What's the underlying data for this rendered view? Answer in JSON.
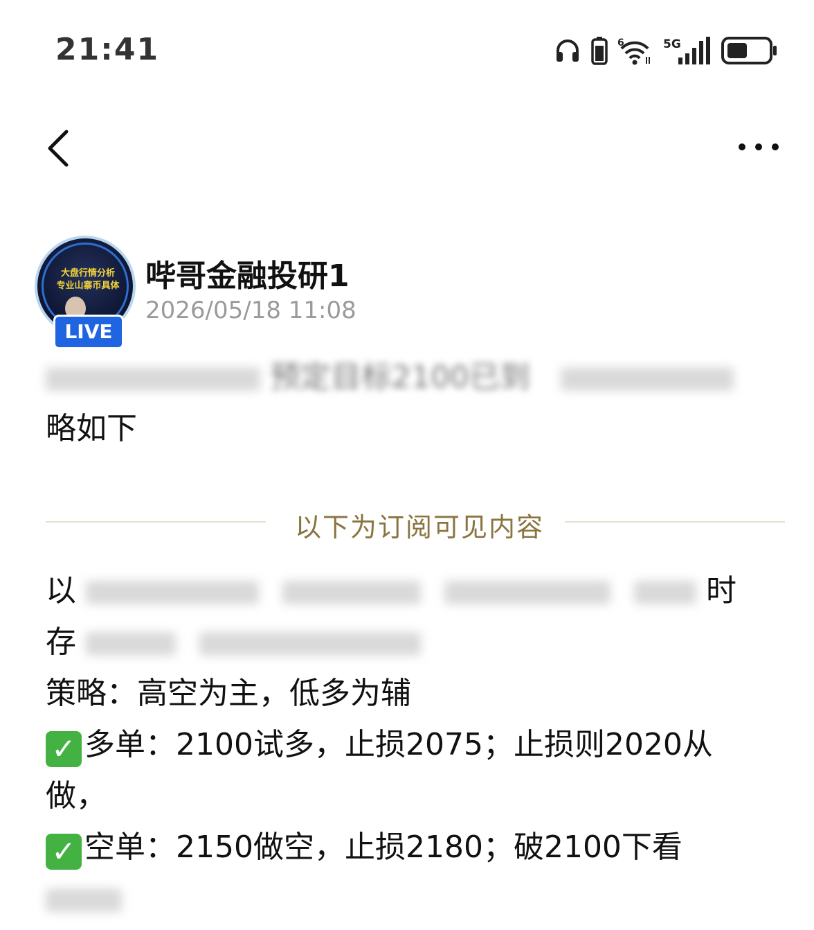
{
  "status_bar": {
    "time": "21:41",
    "icons": [
      "headphones-icon",
      "battery-small-icon",
      "wifi-icon",
      "5g-signal-icon",
      "battery-icon"
    ],
    "network_label": "5G",
    "wifi_label": "6"
  },
  "nav": {
    "back_icon": "chevron-left-icon",
    "more_icon": "more-dots-icon"
  },
  "author": {
    "name": "哔哥金融投研1",
    "time": "2026/05/18 11:08",
    "live_badge": "LIVE",
    "avatar_text_line1": "大盘行情分析",
    "avatar_text_line2": "专业山寨币具体"
  },
  "post": {
    "intro_line1_visible": "预定目标2100已到",
    "intro_line2": "略如下",
    "divider_label": "以下为订阅可见内容",
    "para1_line1_start": "以",
    "para1_line1_end": "时",
    "para1_line2_start": "存",
    "strategy_line": "策略：高空为主，低多为辅",
    "long_line": "多单：2100试多，止损2075；止损则2020从",
    "long_line_cont": "做，",
    "short_line": "空单：2150做空，止损2180；破2100下看"
  },
  "colors": {
    "accent_gold": "#8a7440",
    "live_blue": "#1f64e0",
    "check_green": "#43b243"
  }
}
